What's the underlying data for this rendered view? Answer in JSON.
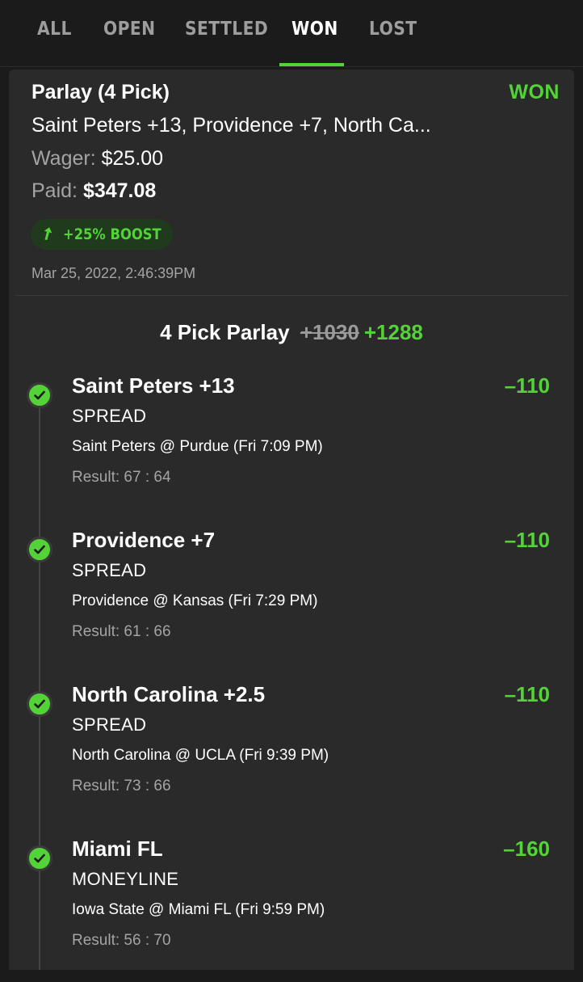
{
  "tabs": [
    {
      "label": "ALL"
    },
    {
      "label": "OPEN"
    },
    {
      "label": "SETTLED"
    },
    {
      "label": "WON"
    },
    {
      "label": "LOST"
    }
  ],
  "active_tab": "WON",
  "accent_color": "#53d337",
  "bet": {
    "title": "Parlay (4 Pick)",
    "status": "WON",
    "description": "Saint Peters +13, Providence +7, North Ca...",
    "wager_label": "Wager:",
    "wager_value": "$25.00",
    "paid_label": "Paid:",
    "paid_value": "$347.08",
    "boost_label": "+25% BOOST",
    "boost_icon": "arrow-up-icon",
    "date": "Mar 25, 2022, 2:46:39PM"
  },
  "parlay": {
    "label": "4 Pick Parlay",
    "old_odds": "+1030",
    "new_odds": "+1288"
  },
  "legs": [
    {
      "name": "Saint Peters +13",
      "odds": "–110",
      "type": "SPREAD",
      "game": "Saint Peters @ Purdue (Fri 7:09 PM)",
      "result": "Result: 67 : 64",
      "icon": "check-circle-icon"
    },
    {
      "name": "Providence +7",
      "odds": "–110",
      "type": "SPREAD",
      "game": "Providence @ Kansas (Fri 7:29 PM)",
      "result": "Result: 61 : 66",
      "icon": "check-circle-icon"
    },
    {
      "name": "North Carolina +2.5",
      "odds": "–110",
      "type": "SPREAD",
      "game": "North Carolina @ UCLA (Fri 9:39 PM)",
      "result": "Result: 73 : 66",
      "icon": "check-circle-icon"
    },
    {
      "name": "Miami FL",
      "odds": "–160",
      "type": "MONEYLINE",
      "game": "Iowa State @ Miami FL (Fri 9:59 PM)",
      "result": "Result: 56 : 70",
      "icon": "check-circle-icon"
    }
  ]
}
